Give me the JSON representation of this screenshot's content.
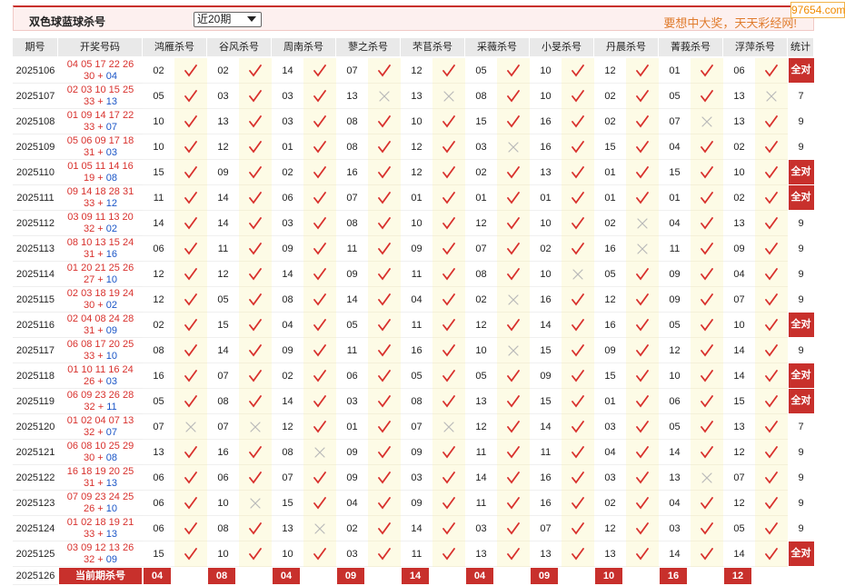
{
  "header": {
    "title": "双色球蓝球杀号",
    "select_value": "近20期",
    "slogan": "要想中大奖，天天彩经网!"
  },
  "watermark": "97654.com",
  "columns": {
    "period": "期号",
    "draw": "开奖号码",
    "experts": [
      "鸿雁杀号",
      "谷风杀号",
      "周南杀号",
      "蓼之杀号",
      "芣苢杀号",
      "采薇杀号",
      "小旻杀号",
      "丹晨杀号",
      "菁莪杀号",
      "浮萍杀号"
    ],
    "stat": "统计"
  },
  "all_hit_label": "全对",
  "rows": [
    {
      "period": "2025106",
      "draw1": "04 05 17 22 26",
      "draw2": "30",
      "blue": "04",
      "kills": [
        "02",
        "02",
        "14",
        "07",
        "12",
        "05",
        "10",
        "12",
        "01",
        "06"
      ],
      "hits": [
        1,
        1,
        1,
        1,
        1,
        1,
        1,
        1,
        1,
        1
      ],
      "stat": "全对"
    },
    {
      "period": "2025107",
      "draw1": "02 03 10 15 25",
      "draw2": "33",
      "blue": "13",
      "kills": [
        "05",
        "03",
        "03",
        "13",
        "13",
        "08",
        "10",
        "02",
        "05",
        "13"
      ],
      "hits": [
        1,
        1,
        1,
        0,
        0,
        1,
        1,
        1,
        1,
        0
      ],
      "stat": "7"
    },
    {
      "period": "2025108",
      "draw1": "01 09 14 17 22",
      "draw2": "33",
      "blue": "07",
      "kills": [
        "10",
        "13",
        "03",
        "08",
        "10",
        "15",
        "16",
        "02",
        "07",
        "13"
      ],
      "hits": [
        1,
        1,
        1,
        1,
        1,
        1,
        1,
        1,
        0,
        1
      ],
      "stat": "9"
    },
    {
      "period": "2025109",
      "draw1": "05 06 09 17 18",
      "draw2": "31",
      "blue": "03",
      "kills": [
        "10",
        "12",
        "01",
        "08",
        "12",
        "03",
        "16",
        "15",
        "04",
        "02"
      ],
      "hits": [
        1,
        1,
        1,
        1,
        1,
        0,
        1,
        1,
        1,
        1
      ],
      "stat": "9"
    },
    {
      "period": "2025110",
      "draw1": "01 05 11 14 16",
      "draw2": "19",
      "blue": "08",
      "kills": [
        "15",
        "09",
        "02",
        "16",
        "12",
        "02",
        "13",
        "01",
        "15",
        "10"
      ],
      "hits": [
        1,
        1,
        1,
        1,
        1,
        1,
        1,
        1,
        1,
        1
      ],
      "stat": "全对"
    },
    {
      "period": "2025111",
      "draw1": "09 14 18 28 31",
      "draw2": "33",
      "blue": "12",
      "kills": [
        "11",
        "14",
        "06",
        "07",
        "01",
        "01",
        "01",
        "01",
        "01",
        "02"
      ],
      "hits": [
        1,
        1,
        1,
        1,
        1,
        1,
        1,
        1,
        1,
        1
      ],
      "stat": "全对"
    },
    {
      "period": "2025112",
      "draw1": "03 09 11 13 20",
      "draw2": "32",
      "blue": "02",
      "kills": [
        "14",
        "14",
        "03",
        "08",
        "10",
        "12",
        "10",
        "02",
        "04",
        "13"
      ],
      "hits": [
        1,
        1,
        1,
        1,
        1,
        1,
        1,
        0,
        1,
        1
      ],
      "stat": "9"
    },
    {
      "period": "2025113",
      "draw1": "08 10 13 15 24",
      "draw2": "31",
      "blue": "16",
      "kills": [
        "06",
        "11",
        "09",
        "11",
        "09",
        "07",
        "02",
        "16",
        "11",
        "09"
      ],
      "hits": [
        1,
        1,
        1,
        1,
        1,
        1,
        1,
        0,
        1,
        1
      ],
      "stat": "9"
    },
    {
      "period": "2025114",
      "draw1": "01 20 21 25 26",
      "draw2": "27",
      "blue": "10",
      "kills": [
        "12",
        "12",
        "14",
        "09",
        "11",
        "08",
        "10",
        "05",
        "09",
        "04"
      ],
      "hits": [
        1,
        1,
        1,
        1,
        1,
        1,
        0,
        1,
        1,
        1
      ],
      "stat": "9"
    },
    {
      "period": "2025115",
      "draw1": "02 03 18 19 24",
      "draw2": "30",
      "blue": "02",
      "kills": [
        "12",
        "05",
        "08",
        "14",
        "04",
        "02",
        "16",
        "12",
        "09",
        "07"
      ],
      "hits": [
        1,
        1,
        1,
        1,
        1,
        0,
        1,
        1,
        1,
        1
      ],
      "stat": "9"
    },
    {
      "period": "2025116",
      "draw1": "02 04 08 24 28",
      "draw2": "31",
      "blue": "09",
      "kills": [
        "02",
        "15",
        "04",
        "05",
        "11",
        "12",
        "14",
        "16",
        "05",
        "10"
      ],
      "hits": [
        1,
        1,
        1,
        1,
        1,
        1,
        1,
        1,
        1,
        1
      ],
      "stat": "全对"
    },
    {
      "period": "2025117",
      "draw1": "06 08 17 20 25",
      "draw2": "33",
      "blue": "10",
      "kills": [
        "08",
        "14",
        "09",
        "11",
        "16",
        "10",
        "15",
        "09",
        "12",
        "14"
      ],
      "hits": [
        1,
        1,
        1,
        1,
        1,
        0,
        1,
        1,
        1,
        1
      ],
      "stat": "9"
    },
    {
      "period": "2025118",
      "draw1": "01 10 11 16 24",
      "draw2": "26",
      "blue": "03",
      "kills": [
        "16",
        "07",
        "02",
        "06",
        "05",
        "05",
        "09",
        "15",
        "10",
        "14"
      ],
      "hits": [
        1,
        1,
        1,
        1,
        1,
        1,
        1,
        1,
        1,
        1
      ],
      "stat": "全对"
    },
    {
      "period": "2025119",
      "draw1": "06 09 23 26 28",
      "draw2": "32",
      "blue": "11",
      "kills": [
        "05",
        "08",
        "14",
        "03",
        "08",
        "13",
        "15",
        "01",
        "06",
        "15"
      ],
      "hits": [
        1,
        1,
        1,
        1,
        1,
        1,
        1,
        1,
        1,
        1
      ],
      "stat": "全对"
    },
    {
      "period": "2025120",
      "draw1": "01 02 04 07 13",
      "draw2": "32",
      "blue": "07",
      "kills": [
        "07",
        "07",
        "12",
        "01",
        "07",
        "12",
        "14",
        "03",
        "05",
        "13"
      ],
      "hits": [
        0,
        0,
        1,
        1,
        0,
        1,
        1,
        1,
        1,
        1
      ],
      "stat": "7"
    },
    {
      "period": "2025121",
      "draw1": "06 08 10 25 29",
      "draw2": "30",
      "blue": "08",
      "kills": [
        "13",
        "16",
        "08",
        "09",
        "09",
        "11",
        "11",
        "04",
        "14",
        "12"
      ],
      "hits": [
        1,
        1,
        0,
        1,
        1,
        1,
        1,
        1,
        1,
        1
      ],
      "stat": "9"
    },
    {
      "period": "2025122",
      "draw1": "16 18 19 20 25",
      "draw2": "31",
      "blue": "13",
      "kills": [
        "06",
        "06",
        "07",
        "09",
        "03",
        "14",
        "16",
        "03",
        "13",
        "07"
      ],
      "hits": [
        1,
        1,
        1,
        1,
        1,
        1,
        1,
        1,
        0,
        1
      ],
      "stat": "9"
    },
    {
      "period": "2025123",
      "draw1": "07 09 23 24 25",
      "draw2": "26",
      "blue": "10",
      "kills": [
        "06",
        "10",
        "15",
        "04",
        "09",
        "11",
        "16",
        "02",
        "04",
        "12"
      ],
      "hits": [
        1,
        0,
        1,
        1,
        1,
        1,
        1,
        1,
        1,
        1
      ],
      "stat": "9"
    },
    {
      "period": "2025124",
      "draw1": "01 02 18 19 21",
      "draw2": "33",
      "blue": "13",
      "kills": [
        "06",
        "08",
        "13",
        "02",
        "14",
        "03",
        "07",
        "12",
        "03",
        "05"
      ],
      "hits": [
        1,
        1,
        0,
        1,
        1,
        1,
        1,
        1,
        1,
        1
      ],
      "stat": "9"
    },
    {
      "period": "2025125",
      "draw1": "03 09 12 13 26",
      "draw2": "32",
      "blue": "09",
      "kills": [
        "15",
        "10",
        "10",
        "03",
        "11",
        "13",
        "13",
        "13",
        "14",
        "14"
      ],
      "hits": [
        1,
        1,
        1,
        1,
        1,
        1,
        1,
        1,
        1,
        1
      ],
      "stat": "全对"
    }
  ],
  "current": {
    "period": "2025126",
    "label": "当前期杀号",
    "kills": [
      "04",
      "08",
      "04",
      "09",
      "14",
      "04",
      "09",
      "10",
      "16",
      "12"
    ]
  }
}
